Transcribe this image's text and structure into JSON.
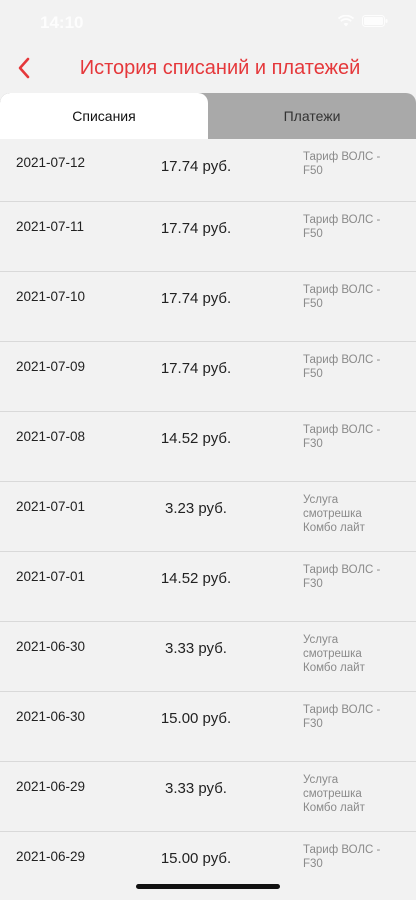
{
  "status_bar": {
    "time": "14:10"
  },
  "header": {
    "title": "История списаний и платежей"
  },
  "tabs": [
    {
      "label": "Списания",
      "active": true
    },
    {
      "label": "Платежи",
      "active": false
    }
  ],
  "rows": [
    {
      "date": "2021-07-12",
      "amount": "17.74 руб.",
      "desc_line1": "Тариф  ВОЛС -",
      "desc_line2": "F50",
      "desc_line3": ""
    },
    {
      "date": "2021-07-11",
      "amount": "17.74 руб.",
      "desc_line1": "Тариф  ВОЛС -",
      "desc_line2": "F50",
      "desc_line3": ""
    },
    {
      "date": "2021-07-10",
      "amount": "17.74 руб.",
      "desc_line1": "Тариф  ВОЛС -",
      "desc_line2": "F50",
      "desc_line3": ""
    },
    {
      "date": "2021-07-09",
      "amount": "17.74 руб.",
      "desc_line1": "Тариф  ВОЛС -",
      "desc_line2": "F50",
      "desc_line3": ""
    },
    {
      "date": "2021-07-08",
      "amount": "14.52 руб.",
      "desc_line1": "Тариф ВОЛС -",
      "desc_line2": "F30",
      "desc_line3": ""
    },
    {
      "date": "2021-07-01",
      "amount": "3.23 руб.",
      "desc_line1": "Услуга",
      "desc_line2": "смотрешка",
      "desc_line3": "Комбо лайт"
    },
    {
      "date": "2021-07-01",
      "amount": "14.52 руб.",
      "desc_line1": "Тариф ВОЛС -",
      "desc_line2": "F30",
      "desc_line3": ""
    },
    {
      "date": "2021-06-30",
      "amount": "3.33 руб.",
      "desc_line1": "Услуга",
      "desc_line2": "смотрешка",
      "desc_line3": "Комбо лайт"
    },
    {
      "date": "2021-06-30",
      "amount": "15.00 руб.",
      "desc_line1": "Тариф ВОЛС -",
      "desc_line2": "F30",
      "desc_line3": ""
    },
    {
      "date": "2021-06-29",
      "amount": "3.33 руб.",
      "desc_line1": "Услуга",
      "desc_line2": "смотрешка",
      "desc_line3": "Комбо лайт"
    },
    {
      "date": "2021-06-29",
      "amount": "15.00 руб.",
      "desc_line1": "Тариф ВОЛС -",
      "desc_line2": "F30",
      "desc_line3": ""
    }
  ],
  "colors": {
    "accent": "#e5383b",
    "tab_bar": "#a9a9a9",
    "background": "#f2f2f2"
  },
  "icons": {
    "back": "chevron-left-icon",
    "wifi": "wifi-icon",
    "battery": "battery-icon"
  }
}
